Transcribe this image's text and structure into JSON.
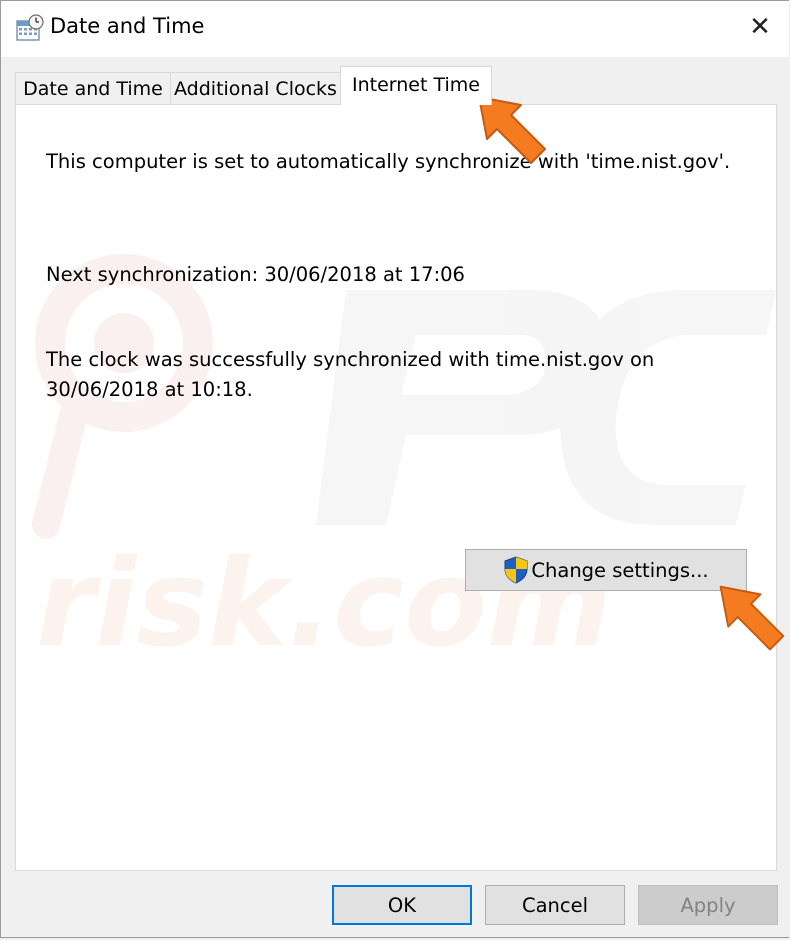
{
  "window": {
    "title": "Date and Time",
    "close_symbol": "✕"
  },
  "tabs": [
    {
      "label": "Date and Time",
      "active": false
    },
    {
      "label": "Additional Clocks",
      "active": false
    },
    {
      "label": "Internet Time",
      "active": true
    }
  ],
  "panel": {
    "sync_server_text": "This computer is set to automatically synchronize with 'time.nist.gov'.",
    "next_sync_text": "Next synchronization: 30/06/2018 at 17:06",
    "last_sync_line1": "The clock was successfully synchronized with time.nist.gov on",
    "last_sync_line2": "30/06/2018 at 10:18.",
    "change_settings_label": "Change settings..."
  },
  "watermark": {
    "text": "risk.com"
  },
  "buttons": {
    "ok": "OK",
    "cancel": "Cancel",
    "apply": "Apply",
    "apply_enabled": false
  },
  "colors": {
    "accent": "#0078d7",
    "annotation_arrow": "#f47b20"
  }
}
